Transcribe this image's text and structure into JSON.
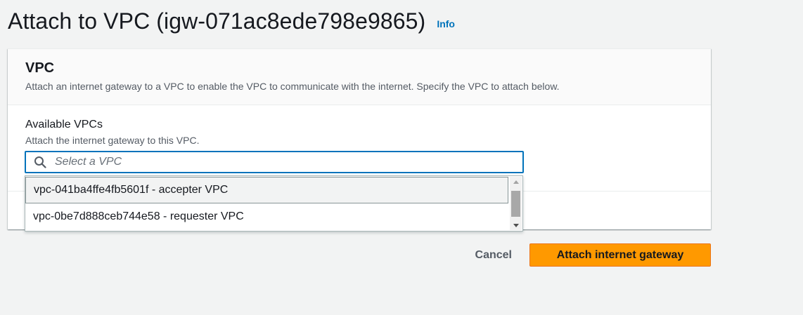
{
  "page": {
    "title": "Attach to VPC (igw-071ac8ede798e9865)",
    "info_link": "Info"
  },
  "container": {
    "title": "VPC",
    "description": "Attach an internet gateway to a VPC to enable the VPC to communicate with the internet. Specify the VPC to attach below."
  },
  "field": {
    "label": "Available VPCs",
    "description": "Attach the internet gateway to this VPC.",
    "placeholder": "Select a VPC",
    "icon": "search-icon"
  },
  "dropdown": {
    "options": [
      {
        "label": "vpc-041ba4ffe4fb5601f - accepter VPC",
        "highlighted": true
      },
      {
        "label": "vpc-0be7d888ceb744e58 - requester VPC",
        "highlighted": false
      }
    ]
  },
  "actions": {
    "cancel_label": "Cancel",
    "primary_label": "Attach internet gateway"
  },
  "colors": {
    "primary_button": "#ff9900",
    "link": "#0073bb",
    "focus_border": "#0073bb",
    "background": "#f2f3f3"
  }
}
